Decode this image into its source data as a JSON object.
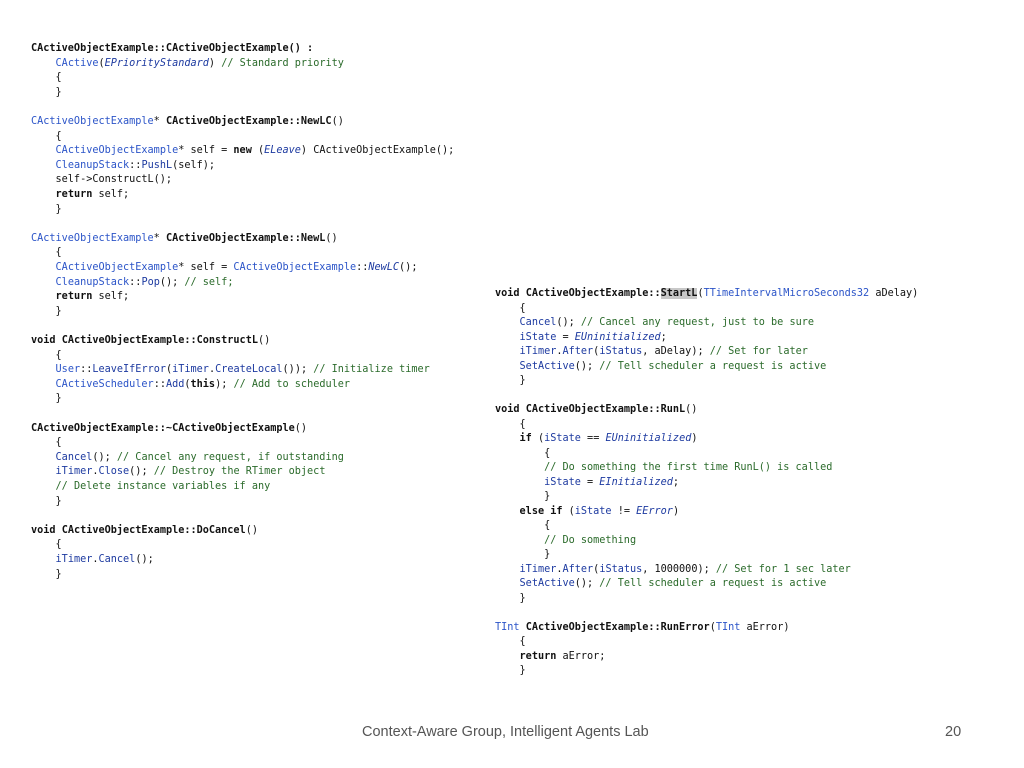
{
  "slide": {
    "footer": "Context-Aware Group, Intelligent Agents Lab",
    "page_number": "20"
  },
  "code_left": [
    [
      [
        "CActiveObjectExample::CActiveObjectExample() :",
        "cls"
      ]
    ],
    [
      [
        "    ",
        "p"
      ],
      [
        "CActive",
        "type"
      ],
      [
        "(",
        "p"
      ],
      [
        "EPriorityStandard",
        "en"
      ],
      [
        ") ",
        "p"
      ],
      [
        "// Standard priority",
        "com"
      ]
    ],
    [
      [
        "    {",
        "p"
      ]
    ],
    [
      [
        "    }",
        "p"
      ]
    ],
    [],
    [
      [
        "CActiveObjectExample",
        "type"
      ],
      [
        "* ",
        "p"
      ],
      [
        "CActiveObjectExample::NewLC",
        "cls"
      ],
      [
        "()",
        "p"
      ]
    ],
    [
      [
        "    {",
        "p"
      ]
    ],
    [
      [
        "    ",
        "p"
      ],
      [
        "CActiveObjectExample",
        "type"
      ],
      [
        "* self = ",
        "p"
      ],
      [
        "new",
        "kw"
      ],
      [
        " (",
        "p"
      ],
      [
        "ELeave",
        "en"
      ],
      [
        ") CActiveObjectExample();",
        "p"
      ]
    ],
    [
      [
        "    ",
        "p"
      ],
      [
        "CleanupStack",
        "type"
      ],
      [
        "::",
        "p"
      ],
      [
        "PushL",
        "fn"
      ],
      [
        "(self);",
        "p"
      ]
    ],
    [
      [
        "    self->ConstructL();",
        "p"
      ]
    ],
    [
      [
        "    ",
        "p"
      ],
      [
        "return",
        "kw"
      ],
      [
        " self;",
        "p"
      ]
    ],
    [
      [
        "    }",
        "p"
      ]
    ],
    [],
    [
      [
        "CActiveObjectExample",
        "type"
      ],
      [
        "* ",
        "p"
      ],
      [
        "CActiveObjectExample::NewL",
        "cls"
      ],
      [
        "()",
        "p"
      ]
    ],
    [
      [
        "    {",
        "p"
      ]
    ],
    [
      [
        "    ",
        "p"
      ],
      [
        "CActiveObjectExample",
        "type"
      ],
      [
        "* self = ",
        "p"
      ],
      [
        "CActiveObjectExample",
        "type"
      ],
      [
        "::",
        "p"
      ],
      [
        "NewLC",
        "en"
      ],
      [
        "();",
        "p"
      ]
    ],
    [
      [
        "    ",
        "p"
      ],
      [
        "CleanupStack",
        "type"
      ],
      [
        "::",
        "p"
      ],
      [
        "Pop",
        "fn"
      ],
      [
        "(); ",
        "p"
      ],
      [
        "// self;",
        "com"
      ]
    ],
    [
      [
        "    ",
        "p"
      ],
      [
        "return",
        "kw"
      ],
      [
        " self;",
        "p"
      ]
    ],
    [
      [
        "    }",
        "p"
      ]
    ],
    [],
    [
      [
        "void",
        "kw"
      ],
      [
        " ",
        "p"
      ],
      [
        "CActiveObjectExample::ConstructL",
        "cls"
      ],
      [
        "()",
        "p"
      ]
    ],
    [
      [
        "    {",
        "p"
      ]
    ],
    [
      [
        "    ",
        "p"
      ],
      [
        "User",
        "type"
      ],
      [
        "::",
        "p"
      ],
      [
        "LeaveIfError",
        "fn"
      ],
      [
        "(",
        "p"
      ],
      [
        "iTimer",
        "mem"
      ],
      [
        ".",
        "p"
      ],
      [
        "CreateLocal",
        "fn"
      ],
      [
        "()); ",
        "p"
      ],
      [
        "// Initialize timer",
        "com"
      ]
    ],
    [
      [
        "    ",
        "p"
      ],
      [
        "CActiveScheduler",
        "type"
      ],
      [
        "::",
        "p"
      ],
      [
        "Add",
        "fn"
      ],
      [
        "(",
        "p"
      ],
      [
        "this",
        "kw"
      ],
      [
        "); ",
        "p"
      ],
      [
        "// Add to scheduler",
        "com"
      ]
    ],
    [
      [
        "    }",
        "p"
      ]
    ],
    [],
    [
      [
        "CActiveObjectExample::~CActiveObjectExample",
        "cls"
      ],
      [
        "()",
        "p"
      ]
    ],
    [
      [
        "    {",
        "p"
      ]
    ],
    [
      [
        "    ",
        "p"
      ],
      [
        "Cancel",
        "fn"
      ],
      [
        "(); ",
        "p"
      ],
      [
        "// Cancel any request, if outstanding",
        "com"
      ]
    ],
    [
      [
        "    ",
        "p"
      ],
      [
        "iTimer",
        "mem"
      ],
      [
        ".",
        "p"
      ],
      [
        "Close",
        "fn"
      ],
      [
        "(); ",
        "p"
      ],
      [
        "// Destroy the RTimer object",
        "com"
      ]
    ],
    [
      [
        "    ",
        "p"
      ],
      [
        "// Delete instance variables if any",
        "com"
      ]
    ],
    [
      [
        "    }",
        "p"
      ]
    ],
    [],
    [
      [
        "void",
        "kw"
      ],
      [
        " ",
        "p"
      ],
      [
        "CActiveObjectExample::DoCancel",
        "cls"
      ],
      [
        "()",
        "p"
      ]
    ],
    [
      [
        "    {",
        "p"
      ]
    ],
    [
      [
        "    ",
        "p"
      ],
      [
        "iTimer",
        "mem"
      ],
      [
        ".",
        "p"
      ],
      [
        "Cancel",
        "fn"
      ],
      [
        "();",
        "p"
      ]
    ],
    [
      [
        "    }",
        "p"
      ]
    ]
  ],
  "code_right": [
    [
      [
        "void",
        "kw"
      ],
      [
        " ",
        "p"
      ],
      [
        "CActiveObjectExample::",
        "cls"
      ],
      [
        "StartL",
        "hl"
      ],
      [
        "(",
        "p"
      ],
      [
        "TTimeIntervalMicroSeconds32",
        "type"
      ],
      [
        " aDelay)",
        "p"
      ]
    ],
    [
      [
        "    {",
        "p"
      ]
    ],
    [
      [
        "    ",
        "p"
      ],
      [
        "Cancel",
        "fn"
      ],
      [
        "(); ",
        "p"
      ],
      [
        "// Cancel any request, just to be sure",
        "com"
      ]
    ],
    [
      [
        "    ",
        "p"
      ],
      [
        "iState",
        "mem"
      ],
      [
        " = ",
        "p"
      ],
      [
        "EUninitialized",
        "en"
      ],
      [
        ";",
        "p"
      ]
    ],
    [
      [
        "    ",
        "p"
      ],
      [
        "iTimer",
        "mem"
      ],
      [
        ".",
        "p"
      ],
      [
        "After",
        "fn"
      ],
      [
        "(",
        "p"
      ],
      [
        "iStatus",
        "mem"
      ],
      [
        ", aDelay); ",
        "p"
      ],
      [
        "// Set for later",
        "com"
      ]
    ],
    [
      [
        "    ",
        "p"
      ],
      [
        "SetActive",
        "fn"
      ],
      [
        "(); ",
        "p"
      ],
      [
        "// Tell scheduler a request is active",
        "com"
      ]
    ],
    [
      [
        "    }",
        "p"
      ]
    ],
    [],
    [
      [
        "void",
        "kw"
      ],
      [
        " ",
        "p"
      ],
      [
        "CActiveObjectExample::RunL",
        "cls"
      ],
      [
        "()",
        "p"
      ]
    ],
    [
      [
        "    {",
        "p"
      ]
    ],
    [
      [
        "    ",
        "p"
      ],
      [
        "if",
        "kw"
      ],
      [
        " (",
        "p"
      ],
      [
        "iState",
        "mem"
      ],
      [
        " == ",
        "p"
      ],
      [
        "EUninitialized",
        "en"
      ],
      [
        ")",
        "p"
      ]
    ],
    [
      [
        "        {",
        "p"
      ]
    ],
    [
      [
        "        ",
        "p"
      ],
      [
        "// Do something the first time RunL() is called",
        "com"
      ]
    ],
    [
      [
        "        ",
        "p"
      ],
      [
        "iState",
        "mem"
      ],
      [
        " = ",
        "p"
      ],
      [
        "EInitialized",
        "en"
      ],
      [
        ";",
        "p"
      ]
    ],
    [
      [
        "        }",
        "p"
      ]
    ],
    [
      [
        "    ",
        "p"
      ],
      [
        "else if",
        "kw"
      ],
      [
        " (",
        "p"
      ],
      [
        "iState",
        "mem"
      ],
      [
        " != ",
        "p"
      ],
      [
        "EError",
        "en"
      ],
      [
        ")",
        "p"
      ]
    ],
    [
      [
        "        {",
        "p"
      ]
    ],
    [
      [
        "        ",
        "p"
      ],
      [
        "// Do something",
        "com"
      ]
    ],
    [
      [
        "        }",
        "p"
      ]
    ],
    [
      [
        "    ",
        "p"
      ],
      [
        "iTimer",
        "mem"
      ],
      [
        ".",
        "p"
      ],
      [
        "After",
        "fn"
      ],
      [
        "(",
        "p"
      ],
      [
        "iStatus",
        "mem"
      ],
      [
        ", 1000000); ",
        "p"
      ],
      [
        "// Set for 1 sec later",
        "com"
      ]
    ],
    [
      [
        "    ",
        "p"
      ],
      [
        "SetActive",
        "fn"
      ],
      [
        "(); ",
        "p"
      ],
      [
        "// Tell scheduler a request is active",
        "com"
      ]
    ],
    [
      [
        "    }",
        "p"
      ]
    ],
    [],
    [
      [
        "TInt",
        "type"
      ],
      [
        " ",
        "p"
      ],
      [
        "CActiveObjectExample::RunError",
        "cls"
      ],
      [
        "(",
        "p"
      ],
      [
        "TInt",
        "type"
      ],
      [
        " aError)",
        "p"
      ]
    ],
    [
      [
        "    {",
        "p"
      ]
    ],
    [
      [
        "    ",
        "p"
      ],
      [
        "return",
        "kw"
      ],
      [
        " aError;",
        "p"
      ]
    ],
    [
      [
        "    }",
        "p"
      ]
    ]
  ]
}
